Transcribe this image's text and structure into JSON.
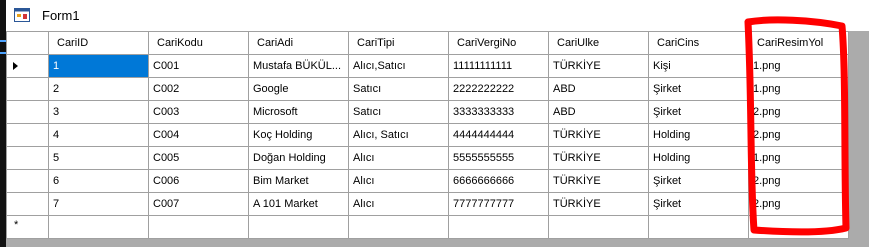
{
  "window": {
    "title": "Form1",
    "accent": "#0078d7",
    "annotation_color": "#ff0000"
  },
  "grid": {
    "columns": [
      "CariID",
      "CariKodu",
      "CariAdi",
      "CariTipi",
      "CariVergiNo",
      "CariUlke",
      "CariCins",
      "CariResimYol"
    ],
    "rows": [
      [
        "1",
        "C001",
        "Mustafa BÜKÜL...",
        "Alıcı,Satıcı",
        "11111111111",
        "TÜRKİYE",
        "Kişi",
        "1.png"
      ],
      [
        "2",
        "C002",
        "Google",
        "Satıcı",
        "2222222222",
        "ABD",
        "Şirket",
        "1.png"
      ],
      [
        "3",
        "C003",
        "Microsoft",
        "Satıcı",
        "3333333333",
        "ABD",
        "Şirket",
        "2.png"
      ],
      [
        "4",
        "C004",
        "Koç Holding",
        "Alıcı, Satıcı",
        "4444444444",
        "TÜRKİYE",
        "Holding",
        "2.png"
      ],
      [
        "5",
        "C005",
        "Doğan Holding",
        "Alıcı",
        "5555555555",
        "TÜRKİYE",
        "Holding",
        "1.png"
      ],
      [
        "6",
        "C006",
        "Bim Market",
        "Alıcı",
        "6666666666",
        "TÜRKİYE",
        "Şirket",
        "2.png"
      ],
      [
        "7",
        "C007",
        "A 101 Market",
        "Alıcı",
        "7777777777",
        "TÜRKİYE",
        "Şirket",
        "2.png"
      ]
    ],
    "selected_row": 0,
    "new_row_marker": "*",
    "current_row_icon": "triangle-right-icon"
  }
}
